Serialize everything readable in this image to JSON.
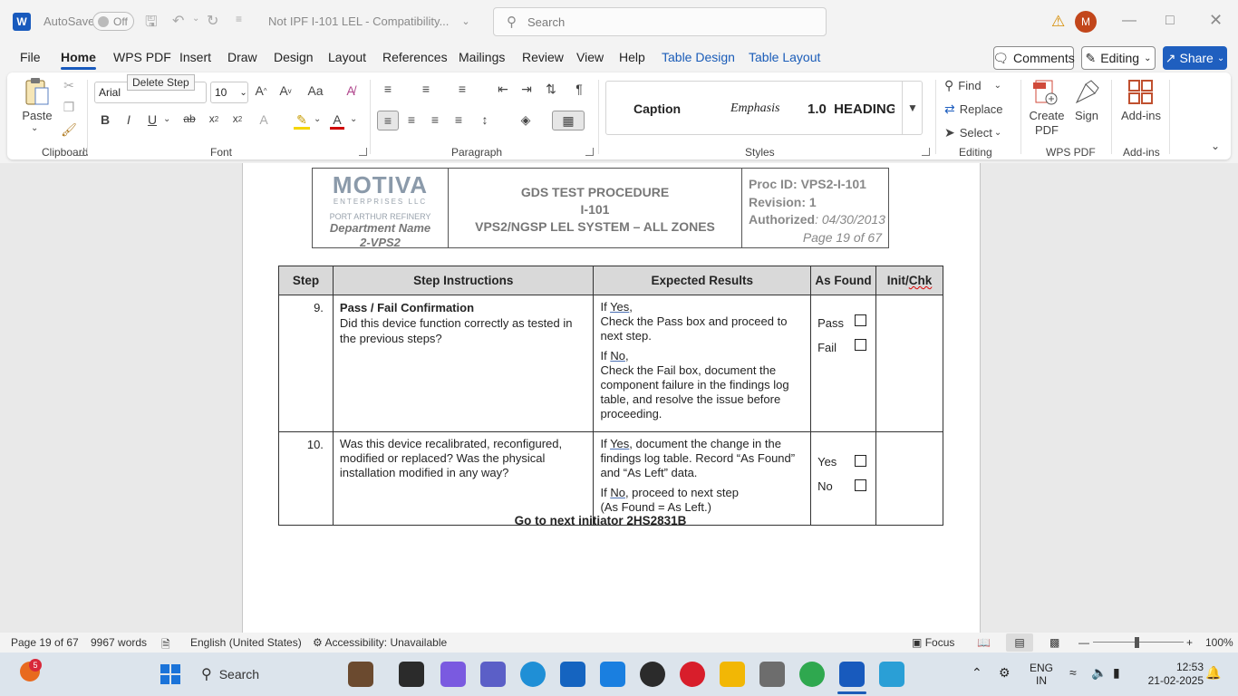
{
  "titlebar": {
    "app_icon": "W",
    "autosave_label": "AutoSave",
    "autosave_state": "Off",
    "doc_title": "Not IPF I-101 LEL  -  Compatibility...",
    "search_placeholder": "Search",
    "avatar_initial": "M"
  },
  "menu": {
    "tabs": [
      "File",
      "Home",
      "WPS PDF",
      "Insert",
      "Draw",
      "Design",
      "Layout",
      "References",
      "Mailings",
      "Review",
      "View",
      "Help",
      "Table Design",
      "Table Layout"
    ],
    "active": "Home",
    "tooltip": "Delete Step",
    "comments_label": "Comments",
    "editing_label": "Editing",
    "share_label": "Share"
  },
  "ribbon": {
    "paste_label": "Paste",
    "font_name": "Arial",
    "font_size": "10",
    "styles": [
      "Caption",
      "Emphasis",
      "1.0  HEADING"
    ],
    "find_label": "Find",
    "replace_label": "Replace",
    "select_label": "Select",
    "create_pdf_label": "Create PDF",
    "sign_label": "Sign",
    "addins_label": "Add-ins",
    "group_labels": {
      "clipboard": "Clipboard",
      "font": "Font",
      "paragraph": "Paragraph",
      "styles": "Styles",
      "editing": "Editing",
      "wpspdf": "WPS PDF",
      "addins": "Add-ins"
    }
  },
  "doc_header": {
    "logo": "MOTIVA",
    "logo_sub": "ENTERPRISES LLC",
    "refinery": "PORT ARTHUR REFINERY",
    "dept_name": "Department Name",
    "dept_code": "2-VPS2",
    "title_line1": "GDS TEST PROCEDURE",
    "title_line2": "I-101",
    "title_line3": "VPS2/NGSP LEL SYSTEM – ALL ZONES",
    "proc_id": "Proc ID: VPS2-I-101",
    "revision": "Revision: 1",
    "authorized_label": "Authorized",
    "authorized_date": ": 04/30/2013",
    "page_info": "Page 19 of 67"
  },
  "table": {
    "headers": [
      "Step",
      "Step Instructions",
      "Expected Results",
      "As Found",
      "Init/Chk"
    ],
    "rows": [
      {
        "step": "9.",
        "instr_title": "Pass / Fail Confirmation",
        "instr_body": "Did this device function correctly as tested in the previous steps?",
        "yes_word": "Yes",
        "yes_text": "Check the Pass box and proceed to next step.",
        "no_word": "No",
        "no_text": "Check the Fail box, document the component failure in the findings log table, and resolve the issue before proceeding.",
        "found_a": "Pass",
        "found_b": "Fail"
      },
      {
        "step": "10.",
        "instr_body": "Was this device recalibrated, reconfigured, modified or replaced? Was the physical installation modified in any way?",
        "yes_word": "Yes",
        "yes_text": ", document the change in the findings log table. Record “As Found” and “As Left” data.",
        "no_word": "No",
        "no_text": ", proceed to next step",
        "no_text2": "(As Found = As Left.)",
        "found_a": "Yes",
        "found_b": "No"
      }
    ],
    "goto": "Go to next initiator 2HS2831B"
  },
  "statusbar": {
    "page": "Page 19 of 67",
    "words": "9967 words",
    "language": "English (United States)",
    "accessibility": "Accessibility: Unavailable",
    "focus": "Focus",
    "zoom": "100%"
  },
  "taskbar": {
    "search_label": "Search",
    "notif_count": "5",
    "lang_line1": "ENG",
    "lang_line2": "IN",
    "time": "12:53",
    "date": "21-02-2025"
  }
}
